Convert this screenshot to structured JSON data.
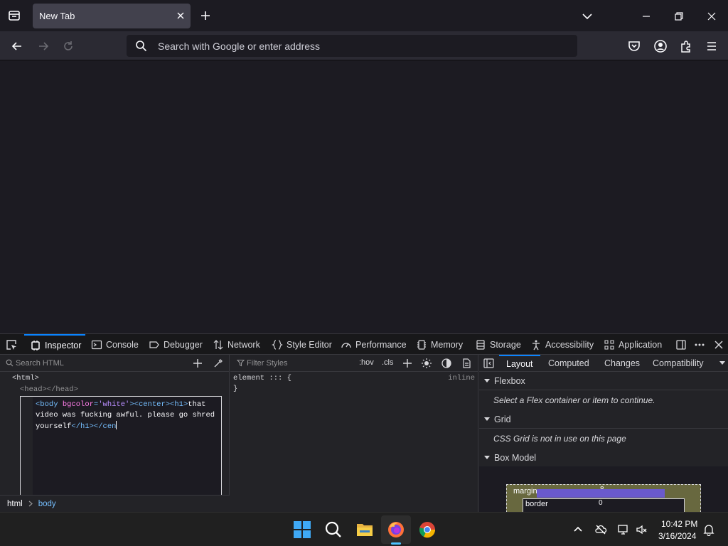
{
  "browser": {
    "tab_title": "New Tab",
    "url_placeholder": "Search with Google or enter address"
  },
  "devtools": {
    "tabs": [
      "Inspector",
      "Console",
      "Debugger",
      "Network",
      "Style Editor",
      "Performance",
      "Memory",
      "Storage",
      "Accessibility",
      "Application"
    ],
    "active_tab": "Inspector",
    "markup": {
      "search_placeholder": "Search HTML",
      "html_node": "<html>",
      "head_node": "<head></head>",
      "editor_parts": {
        "t1": "<body ",
        "a1": "bgcolor",
        "eq": "=",
        "v1": "'white'",
        "t2": "><center><h1>",
        "text": "that video was fucking awful. please go shred yourself",
        "t3": "</h1></cen"
      }
    },
    "breadcrumbs": {
      "first": "html",
      "second": "body"
    },
    "rules": {
      "filter_placeholder": "Filter Styles",
      "hov": ":hov",
      "cls": ".cls",
      "selector": "element ::: {",
      "close_brace": "}",
      "source": "inline"
    },
    "layout": {
      "tabs": [
        "Layout",
        "Computed",
        "Changes",
        "Compatibility"
      ],
      "active_tab": "Layout",
      "flexbox_title": "Flexbox",
      "flexbox_msg": "Select a Flex container or item to continue.",
      "grid_title": "Grid",
      "grid_msg": "CSS Grid is not in use on this page",
      "boxmodel_title": "Box Model",
      "margin_label": "margin",
      "margin_value": "8",
      "border_label": "border",
      "border_value": "0"
    }
  },
  "taskbar": {
    "time": "10:42 PM",
    "date": "3/16/2024"
  }
}
